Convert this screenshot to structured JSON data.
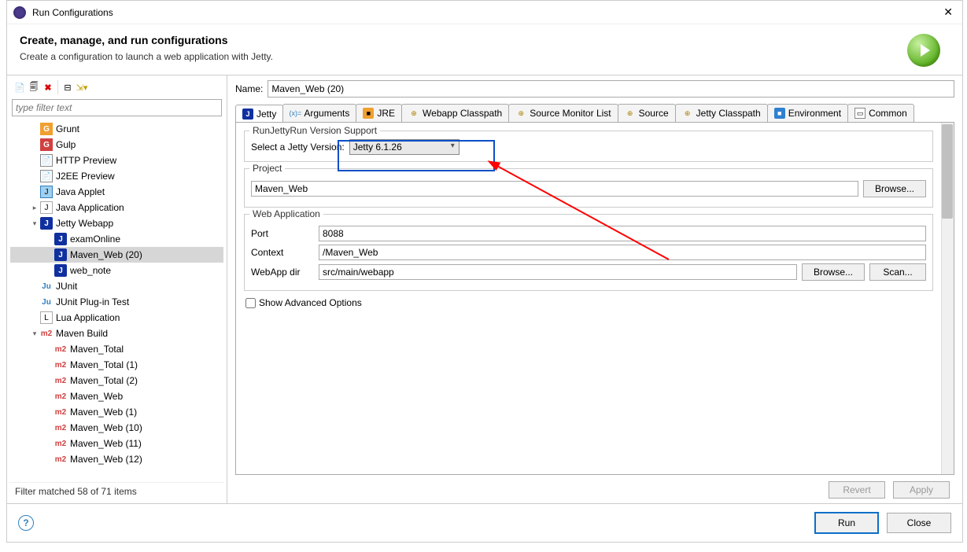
{
  "window": {
    "title": "Run Configurations"
  },
  "header": {
    "title": "Create, manage, and run configurations",
    "subtitle": "Create a configuration to launch a web application with Jetty."
  },
  "filter": {
    "placeholder": "type filter text"
  },
  "tree": [
    {
      "label": "Grunt",
      "icon": "grunt",
      "depth": 1,
      "exp": ""
    },
    {
      "label": "Gulp",
      "icon": "gulp",
      "depth": 1,
      "exp": ""
    },
    {
      "label": "HTTP Preview",
      "icon": "http",
      "depth": 1,
      "exp": ""
    },
    {
      "label": "J2EE Preview",
      "icon": "j2ee",
      "depth": 1,
      "exp": ""
    },
    {
      "label": "Java Applet",
      "icon": "applet",
      "depth": 1,
      "exp": ""
    },
    {
      "label": "Java Application",
      "icon": "java",
      "depth": 1,
      "exp": "▸"
    },
    {
      "label": "Jetty Webapp",
      "icon": "jetty",
      "depth": 1,
      "exp": "▾"
    },
    {
      "label": "examOnline",
      "icon": "jetty",
      "depth": 2,
      "exp": ""
    },
    {
      "label": "Maven_Web (20)",
      "icon": "jetty",
      "depth": 2,
      "exp": "",
      "selected": true
    },
    {
      "label": "web_note",
      "icon": "jetty",
      "depth": 2,
      "exp": ""
    },
    {
      "label": "JUnit",
      "icon": "junit",
      "depth": 1,
      "exp": ""
    },
    {
      "label": "JUnit Plug-in Test",
      "icon": "junit",
      "depth": 1,
      "exp": ""
    },
    {
      "label": "Lua Application",
      "icon": "lua",
      "depth": 1,
      "exp": ""
    },
    {
      "label": "Maven Build",
      "icon": "m2",
      "depth": 1,
      "exp": "▾"
    },
    {
      "label": "Maven_Total",
      "icon": "m2",
      "depth": 2,
      "exp": ""
    },
    {
      "label": "Maven_Total (1)",
      "icon": "m2",
      "depth": 2,
      "exp": ""
    },
    {
      "label": "Maven_Total (2)",
      "icon": "m2",
      "depth": 2,
      "exp": ""
    },
    {
      "label": "Maven_Web",
      "icon": "m2",
      "depth": 2,
      "exp": ""
    },
    {
      "label": "Maven_Web (1)",
      "icon": "m2",
      "depth": 2,
      "exp": ""
    },
    {
      "label": "Maven_Web (10)",
      "icon": "m2",
      "depth": 2,
      "exp": ""
    },
    {
      "label": "Maven_Web (11)",
      "icon": "m2",
      "depth": 2,
      "exp": ""
    },
    {
      "label": "Maven_Web (12)",
      "icon": "m2",
      "depth": 2,
      "exp": ""
    }
  ],
  "filter_status": "Filter matched 58 of 71 items",
  "form": {
    "name_label": "Name:",
    "name_value": "Maven_Web (20)"
  },
  "tabs": [
    {
      "label": "Jetty",
      "icon": "jetty",
      "active": true
    },
    {
      "label": "Arguments",
      "icon": "args"
    },
    {
      "label": "JRE",
      "icon": "jre"
    },
    {
      "label": "Webapp Classpath",
      "icon": "cp"
    },
    {
      "label": "Source Monitor List",
      "icon": "cp"
    },
    {
      "label": "Source",
      "icon": "cp"
    },
    {
      "label": "Jetty Classpath",
      "icon": "cp"
    },
    {
      "label": "Environment",
      "icon": "env"
    },
    {
      "label": "Common",
      "icon": "common"
    }
  ],
  "jetty": {
    "version_group": "RunJettyRun Version Support",
    "version_label": "Select a Jetty Version:",
    "version_value": "Jetty 6.1.26",
    "project_group": "Project",
    "project_value": "Maven_Web",
    "browse": "Browse...",
    "scan": "Scan...",
    "webapp_group": "Web Application",
    "port_label": "Port",
    "port_value": "8088",
    "context_label": "Context",
    "context_value": "/Maven_Web",
    "webappdir_label": "WebApp dir",
    "webappdir_value": "src/main/webapp",
    "show_advanced": "Show Advanced Options"
  },
  "buttons": {
    "revert": "Revert",
    "apply": "Apply",
    "run": "Run",
    "close": "Close"
  },
  "icon_glyph": {
    "grunt": "G",
    "gulp": "G",
    "http": "📄",
    "j2ee": "📄",
    "applet": "J",
    "java": "J",
    "jetty": "J",
    "junit": "Ju",
    "lua": "L",
    "m2": "m2",
    "args": "(x)=",
    "jre": "■",
    "cp": "⊕",
    "env": "■",
    "common": "▭"
  }
}
